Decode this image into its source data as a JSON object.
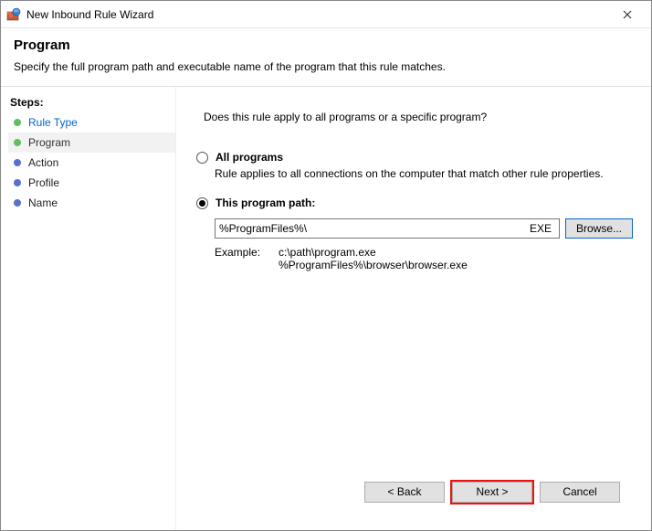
{
  "window": {
    "title": "New Inbound Rule Wizard"
  },
  "header": {
    "title": "Program",
    "subtitle": "Specify the full program path and executable name of the program that this rule matches."
  },
  "sidebar": {
    "title": "Steps:",
    "items": [
      {
        "label": "Rule Type"
      },
      {
        "label": "Program"
      },
      {
        "label": "Action"
      },
      {
        "label": "Profile"
      },
      {
        "label": "Name"
      }
    ]
  },
  "main": {
    "question": "Does this rule apply to all programs or a specific program?",
    "option_all": {
      "label": "All programs",
      "desc": "Rule applies to all connections on the computer that match other rule properties."
    },
    "option_path": {
      "label": "This program path:",
      "value": "%ProgramFiles%\\",
      "ext_hint": "EXE",
      "browse": "Browse..."
    },
    "example": {
      "label": "Example:",
      "paths": "c:\\path\\program.exe\n%ProgramFiles%\\browser\\browser.exe"
    }
  },
  "footer": {
    "back": "< Back",
    "next": "Next >",
    "cancel": "Cancel"
  }
}
